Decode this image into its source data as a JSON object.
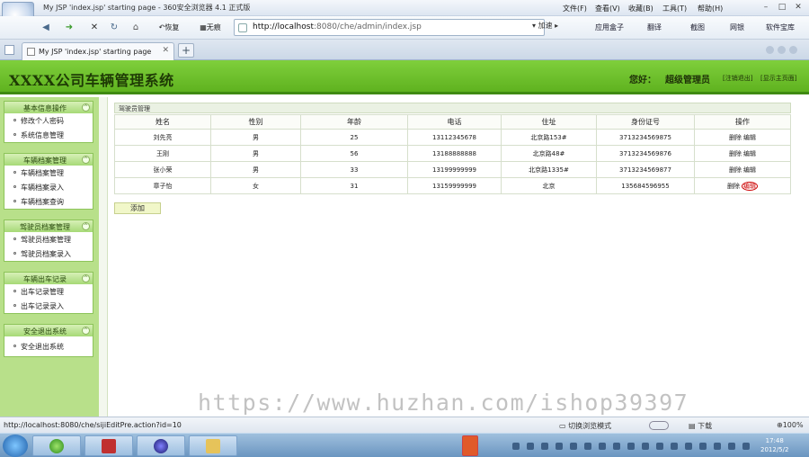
{
  "window": {
    "title": "My JSP 'index.jsp' starting page - 360安全浏览器 4.1 正式版",
    "menus": [
      "文件(F)",
      "查看(V)",
      "收藏(B)",
      "工具(T)",
      "帮助(H)"
    ]
  },
  "nav": {
    "back_label": "恢复",
    "nohistory_label": "无痕",
    "address_host": "http://localhost",
    "address_rest": ":8080/che/admin/index.jsp",
    "go_label": "加速",
    "toolbar_items": [
      "应用盒子",
      "翻译",
      "截图",
      "网银",
      "软件宝库"
    ]
  },
  "tab": {
    "title": "My JSP 'index.jsp' starting page"
  },
  "page": {
    "system_title": "XXXX公司车辆管理系统",
    "greeting": "您好：",
    "user": "超级管理员",
    "logout_label": "[注销退出]",
    "home_label": "[显示主页面]"
  },
  "sidebar": [
    {
      "title": "基本信息操作",
      "items": [
        "修改个人密码",
        "系统信息管理"
      ]
    },
    {
      "title": "车辆档案管理",
      "items": [
        "车辆档案管理",
        "车辆档案录入",
        "车辆档案查询"
      ]
    },
    {
      "title": "驾驶员档案管理",
      "items": [
        "驾驶员档案管理",
        "驾驶员档案录入"
      ]
    },
    {
      "title": "车辆出车记录",
      "items": [
        "出车记录管理",
        "出车记录录入"
      ]
    },
    {
      "title": "安全退出系统",
      "items": [
        "安全退出系统"
      ]
    }
  ],
  "content": {
    "caption": "驾驶员管理",
    "columns": [
      "姓名",
      "性别",
      "年龄",
      "电话",
      "住址",
      "身份证号",
      "操作"
    ],
    "rows": [
      {
        "name": "刘先亮",
        "gender": "男",
        "age": "25",
        "phone": "13112345678",
        "address": "北京路153#",
        "id": "3713234569875",
        "del": "删除",
        "edit": "编辑"
      },
      {
        "name": "王刚",
        "gender": "男",
        "age": "56",
        "phone": "13188888888",
        "address": "北京路48#",
        "id": "3713234569876",
        "del": "删除",
        "edit": "编辑"
      },
      {
        "name": "张小荣",
        "gender": "男",
        "age": "33",
        "phone": "13199999999",
        "address": "北京路1335#",
        "id": "3713234569877",
        "del": "删除",
        "edit": "编辑"
      },
      {
        "name": "章子怡",
        "gender": "女",
        "age": "31",
        "phone": "13159999999",
        "address": "北京",
        "id": "135684596955",
        "del": "删除",
        "edit": "编辑"
      }
    ],
    "add_label": "添加"
  },
  "watermark": "https://www.huzhan.com/ishop39397",
  "status": {
    "url": "http://localhost:8080/che/sijiEditPre.action?id=10",
    "mode_label": "切换浏览模式",
    "download_label": "下载",
    "zoom": "100%"
  },
  "clock": {
    "time": "17:48",
    "date": "2012/5/2"
  }
}
